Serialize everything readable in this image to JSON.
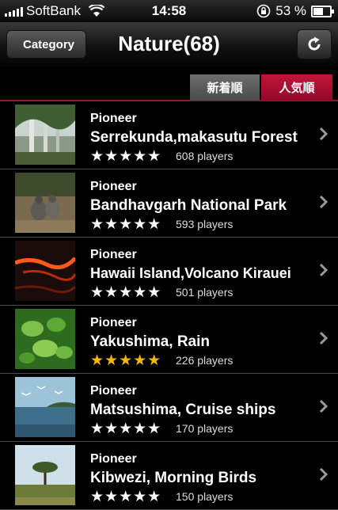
{
  "status_bar": {
    "carrier": "SoftBank",
    "time": "14:58",
    "battery": "53 %"
  },
  "nav": {
    "back_label": "Category",
    "title": "Nature(68)",
    "refresh_icon": "refresh-icon"
  },
  "segments": {
    "new": "新着順",
    "popular": "人気順",
    "selected": "popular"
  },
  "items": [
    {
      "author": "Pioneer",
      "name": "Serrekunda,makasutu Forest",
      "rating": 0,
      "players": "608 players"
    },
    {
      "author": "Pioneer",
      "name": "Bandhavgarh National Park",
      "rating": 0,
      "players": "593 players"
    },
    {
      "author": "Pioneer",
      "name": "Hawaii Island,Volcano Kirauei",
      "rating": 0,
      "players": "501 players"
    },
    {
      "author": "Pioneer",
      "name": "Yakushima, Rain",
      "rating": 5,
      "players": "226 players"
    },
    {
      "author": "Pioneer",
      "name": "Matsushima, Cruise ships",
      "rating": 0,
      "players": "170 players"
    },
    {
      "author": "Pioneer",
      "name": "Kibwezi, Morning Birds",
      "rating": 0,
      "players": "150 players"
    }
  ],
  "colors": {
    "accent": "#b0122f",
    "star_gold": "#f5b800",
    "star_white": "#ffffff"
  }
}
